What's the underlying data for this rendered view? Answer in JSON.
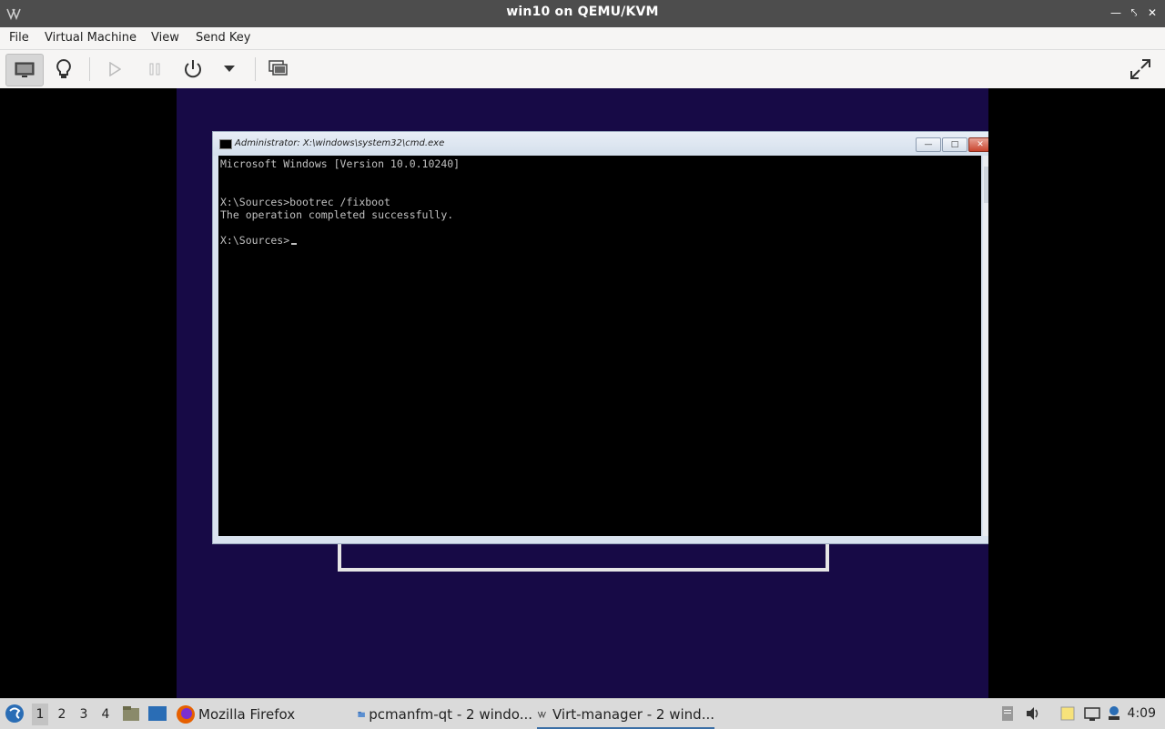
{
  "window": {
    "title": "win10 on QEMU/KVM"
  },
  "menubar": {
    "items": [
      "File",
      "Virtual Machine",
      "View",
      "Send Key"
    ]
  },
  "toolbar": {
    "buttons": [
      "console-view",
      "details-view",
      "run",
      "pause",
      "shutdown",
      "shutdown-menu",
      "snapshots",
      "fullscreen"
    ]
  },
  "vm": {
    "cmd_title": "Administrator: X:\\windows\\system32\\cmd.exe",
    "console_lines": [
      "Microsoft Windows [Version 10.0.10240]",
      "",
      "",
      "X:\\Sources>bootrec /fixboot",
      "The operation completed successfully.",
      "",
      "X:\\Sources>"
    ]
  },
  "taskbar": {
    "workspaces": [
      "1",
      "2",
      "3",
      "4"
    ],
    "tasks": {
      "firefox": "Mozilla Firefox",
      "pcmanfm": "pcmanfm-qt - 2 windo...",
      "virtmanager": "Virt-manager - 2 wind..."
    },
    "clock": "4:09"
  },
  "colors": {
    "titlebar": "#4d4d4d",
    "vm_background": "#170a46",
    "console_bg": "#000000",
    "console_text": "#c0c0c0"
  }
}
